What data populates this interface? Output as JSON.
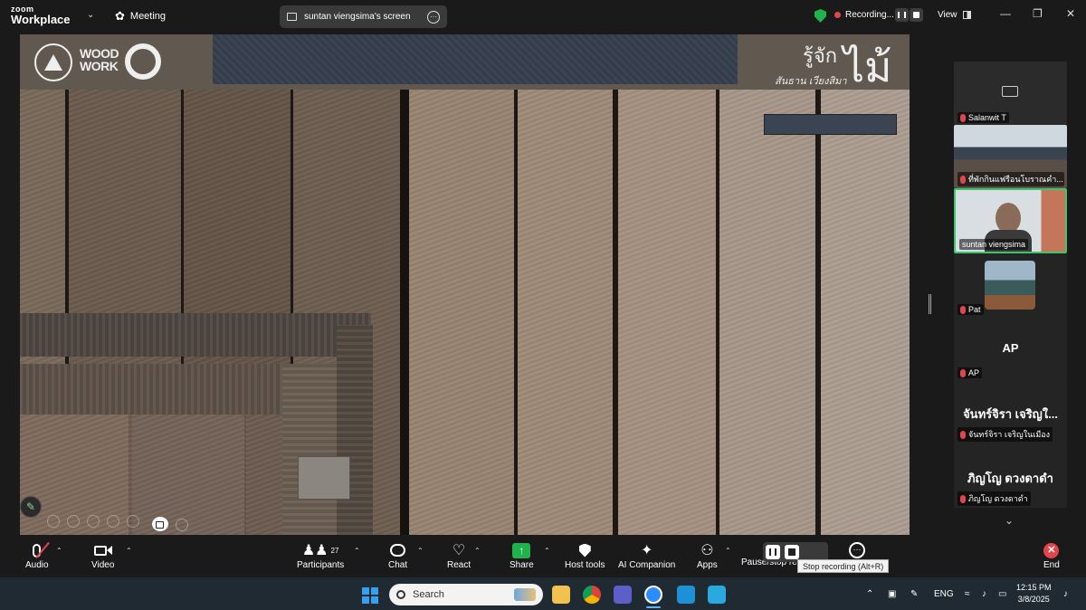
{
  "topbar": {
    "brand_line1": "zoom",
    "brand_line2": "Workplace",
    "meeting_label": "Meeting",
    "screen_label": "suntan viengsima's screen",
    "recording_label": "Recording...",
    "view_label": "View",
    "accent_green": "#22b24c",
    "record_red": "#e0464c"
  },
  "shared_screen": {
    "logo_text_line1": "WOOD",
    "logo_text_line2": "WORK",
    "title_thai": "รู้จัก",
    "title_big": "ไม้",
    "subtitle": "สันธาน เวียงสิมา"
  },
  "participants": [
    {
      "name": "Salanwit T",
      "muted": true,
      "video": false
    },
    {
      "name": "ที่พักกินแฟรือนโบราณคำ...",
      "muted": true,
      "video": true
    },
    {
      "name": "suntan viengsima",
      "muted": false,
      "video": true,
      "active": true
    },
    {
      "name": "Pat",
      "muted": true,
      "video": false
    },
    {
      "name": "AP",
      "display": "AP",
      "muted": true,
      "video": false
    },
    {
      "name": "จันทร์จิรา  เจริญในเมือง",
      "display": "จันทร์จิรา  เจริญใ...",
      "muted": true,
      "video": false
    },
    {
      "name": "ภิญโญ  ดวงดาดำ",
      "display": "ภิญโญ  ดวงดาดำ",
      "muted": true,
      "video": false
    }
  ],
  "toolbar": {
    "audio": "Audio",
    "video": "Video",
    "participants": "Participants",
    "participants_count": "27",
    "chat": "Chat",
    "react": "React",
    "share": "Share",
    "host_tools": "Host tools",
    "ai_companion": "AI Companion",
    "apps": "Apps",
    "pause_stop": "Pause/stop rec",
    "more": "",
    "end": "End",
    "tooltip": "Stop recording (Alt+R)"
  },
  "taskbar": {
    "search_placeholder": "Search",
    "language": "ENG",
    "time": "12:15 PM",
    "date": "3/8/2025"
  }
}
